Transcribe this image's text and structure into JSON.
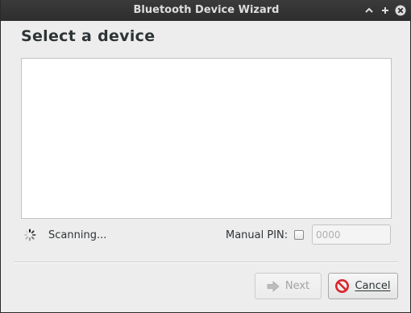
{
  "window": {
    "title": "Bluetooth Device Wizard",
    "controls": [
      "minimize-icon",
      "maximize-icon",
      "close-icon"
    ]
  },
  "page": {
    "heading": "Select a device"
  },
  "device_list": {
    "items": []
  },
  "status": {
    "icon": "spinner-icon",
    "text": "Scanning..."
  },
  "pin": {
    "label": "Manual PIN:",
    "checked": false,
    "placeholder": "0000",
    "value": ""
  },
  "buttons": {
    "next": {
      "label": "Next",
      "icon": "arrow-right-icon",
      "enabled": false
    },
    "cancel": {
      "label": "Cancel",
      "icon": "stop-icon",
      "enabled": true
    }
  },
  "colors": {
    "titlebar": "#2d2d2d",
    "background": "#ededed",
    "cancel_icon": "#d9262c"
  }
}
